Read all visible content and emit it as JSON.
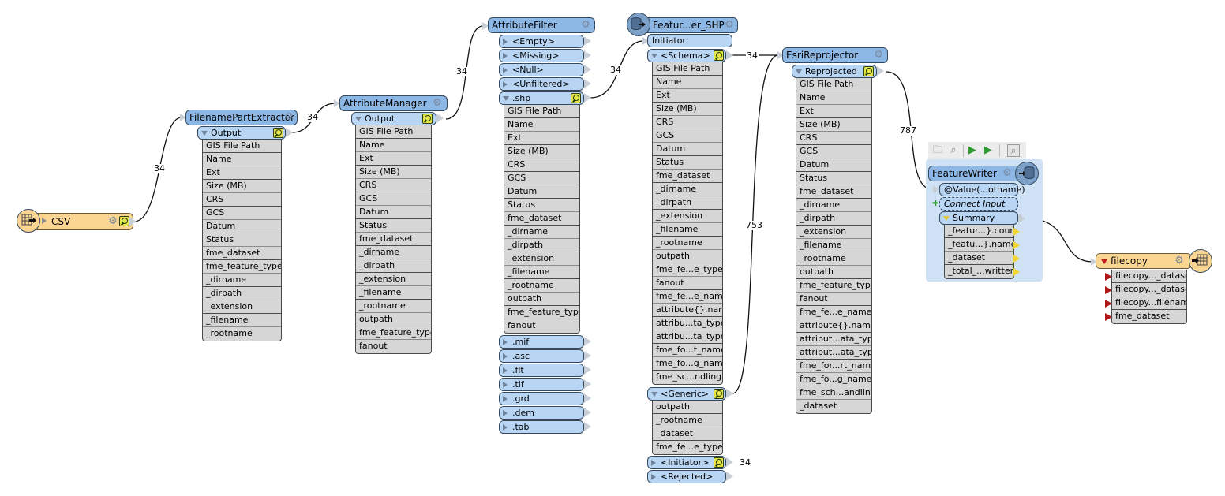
{
  "colors": {
    "transformer_header": "#8db8e6",
    "port": "#b8d5f3",
    "reader_writer_header": "#fbd592",
    "attribute_row": "#d6d6d6",
    "inspector_icon": "#e7e44a",
    "writer_panel": "#cfe1f5"
  },
  "nodes": {
    "csv": {
      "title": "CSV",
      "type": "reader-feature-type"
    },
    "filename_part_extractor": {
      "title": "FilenamePartExtractor",
      "output_port": "Output",
      "attributes": [
        "GIS File Path",
        "Name",
        "Ext",
        "Size (MB)",
        "CRS",
        "GCS",
        "Datum",
        "Status",
        "fme_dataset",
        "fme_feature_type",
        "_dirname",
        "_dirpath",
        "_extension",
        "_filename",
        "_rootname"
      ]
    },
    "attribute_manager": {
      "title": "AttributeManager",
      "output_port": "Output",
      "attributes": [
        "GIS File Path",
        "Name",
        "Ext",
        "Size (MB)",
        "CRS",
        "GCS",
        "Datum",
        "Status",
        "fme_dataset",
        "_dirname",
        "_dirpath",
        "_extension",
        "_filename",
        "_rootname",
        "outpath",
        "fme_feature_type",
        "fanout"
      ]
    },
    "attribute_filter": {
      "title": "AttributeFilter",
      "ports_top": [
        "<Empty>",
        "<Missing>",
        "<Null>",
        "<Unfiltered>"
      ],
      "shp_port": ".shp",
      "shp_attributes": [
        "GIS File Path",
        "Name",
        "Ext",
        "Size (MB)",
        "CRS",
        "GCS",
        "Datum",
        "Status",
        "fme_dataset",
        "_dirname",
        "_dirpath",
        "_extension",
        "_filename",
        "_rootname",
        "outpath",
        "fme_feature_type",
        "fanout"
      ],
      "ports_bottom": [
        ".mif",
        ".asc",
        ".flt",
        ".tif",
        ".grd",
        ".dem",
        ".tab"
      ]
    },
    "feature_reader": {
      "title": "Featur...er_SHP",
      "input_port": "Initiator",
      "schema_port": "<Schema>",
      "schema_attributes": [
        "GIS File Path",
        "Name",
        "Ext",
        "Size (MB)",
        "CRS",
        "GCS",
        "Datum",
        "Status",
        "fme_dataset",
        "_dirname",
        "_dirpath",
        "_extension",
        "_filename",
        "_rootname",
        "outpath",
        "fme_fe...e_type",
        "fanout",
        "fme_fe...e_name",
        "attribute{}.name",
        "attribu...ta_type",
        "attribu...ta_type",
        "fme_fo...t_name",
        "fme_fo...g_name",
        "fme_sc...ndling"
      ],
      "generic_port": "<Generic>",
      "generic_attributes": [
        "outpath",
        "_rootname",
        "_dataset",
        "fme_fe...e_type"
      ],
      "initiator_out_port": "<Initiator>",
      "rejected_port": "<Rejected>"
    },
    "esri_reprojector": {
      "title": "EsriReprojector",
      "output_port": "Reprojected",
      "attributes": [
        "GIS File Path",
        "Name",
        "Ext",
        "Size (MB)",
        "CRS",
        "GCS",
        "Datum",
        "Status",
        "fme_dataset",
        "_dirname",
        "_dirpath",
        "_extension",
        "_filename",
        "_rootname",
        "outpath",
        "fme_feature_type",
        "fanout",
        "fme_fe...e_name",
        "attribute{}.name",
        "attribut...ata_type",
        "attribut...ata_type",
        "fme_for...rt_name",
        "fme_fo...g_name",
        "fme_sch...andling",
        "_dataset"
      ]
    },
    "feature_writer": {
      "title": "FeatureWriter",
      "input_port": "@Value(...otname)",
      "connect_input": "Connect Input",
      "summary_port": "Summary",
      "summary_attributes": [
        "_featur...}.count",
        "_featu...}.name",
        "_dataset",
        "_total_...written"
      ],
      "toolbar": [
        "open-dataset-icon",
        "inspect-icon",
        "run-to-this-icon",
        "run-from-this-icon",
        "inspect-cache-icon"
      ]
    },
    "filecopy": {
      "title": "filecopy",
      "type": "writer-feature-type",
      "attributes": [
        "filecopy..._dataset",
        "filecopy..._dataset",
        "filecopy...filename",
        "fme_dataset"
      ]
    }
  },
  "links": [
    {
      "from": "CSV",
      "to": "FilenamePartExtractor",
      "count": "34"
    },
    {
      "from": "FilenamePartExtractor.Output",
      "to": "AttributeManager",
      "count": "34"
    },
    {
      "from": "AttributeManager.Output",
      "to": "AttributeFilter",
      "count": "34"
    },
    {
      "from": "AttributeFilter..shp",
      "to": "FeatureReader.Initiator",
      "count": "34"
    },
    {
      "from": "FeatureReader.<Schema>",
      "to": "EsriReprojector",
      "count": "34"
    },
    {
      "from": "FeatureReader.<Generic>",
      "to": "EsriReprojector",
      "count": "753"
    },
    {
      "from": "EsriReprojector.Reprojected",
      "to": "FeatureWriter",
      "count": "787"
    },
    {
      "from": "FeatureWriter.Summary",
      "to": "filecopy",
      "count": ""
    },
    {
      "from": "FeatureReader.<Initiator>",
      "to": "",
      "count": "34"
    }
  ]
}
